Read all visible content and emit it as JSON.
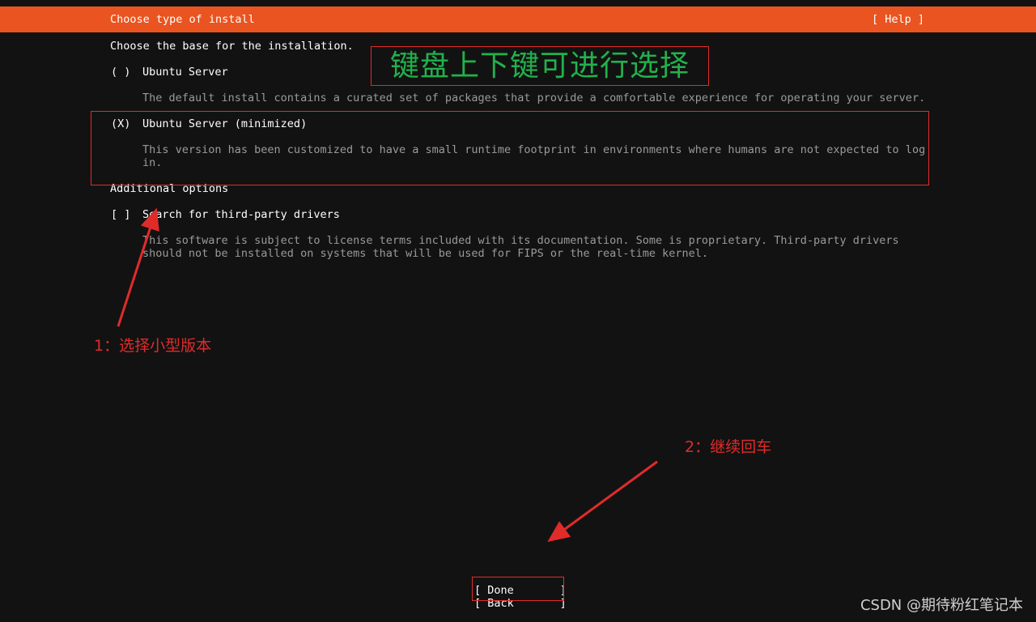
{
  "header": {
    "title": "Choose type of install",
    "help": "[ Help ]"
  },
  "intro": "Choose the base for the installation.",
  "options": [
    {
      "marker": "( )",
      "label": "Ubuntu Server",
      "desc1": "The default install contains a curated set of packages that provide a comfortable experience for operating your server.",
      "desc2": ""
    },
    {
      "marker": "(X)",
      "label": "Ubuntu Server (minimized)",
      "desc1": "This version has been customized to have a small runtime footprint in environments where humans are not expected to log",
      "desc2": "in."
    }
  ],
  "additional": {
    "heading": "Additional options",
    "checkbox_marker": "[ ]",
    "checkbox_label": "Search for third-party drivers",
    "desc1": "This software is subject to license terms included with its documentation. Some is proprietary. Third-party drivers",
    "desc2": "should not be installed on systems that will be used for FIPS or the real-time kernel."
  },
  "buttons": {
    "done": "[ Done       ]",
    "back": "[ Back       ]"
  },
  "annotations": {
    "hint": "键盘上下键可进行选择",
    "note1": "1：选择小型版本",
    "note2": "2：继续回车"
  },
  "watermark": "CSDN @期待粉红笔记本",
  "colors": {
    "header_bg": "#E95420",
    "background": "#121212",
    "annotation_red": "#e02b2b",
    "hint_green": "#22b14c"
  }
}
